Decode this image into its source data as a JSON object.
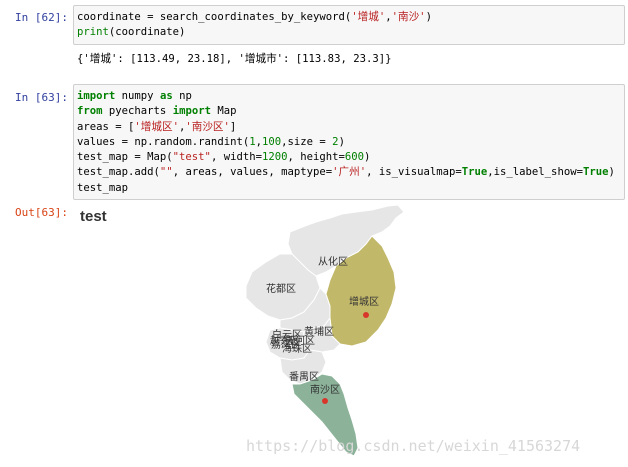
{
  "cells": [
    {
      "prompt": "In [62]:",
      "code_lines": [
        [
          {
            "t": "n",
            "v": "coordinate = search_coordinates_by_keyword("
          },
          {
            "t": "s",
            "v": "'增城'"
          },
          {
            "t": "n",
            "v": ","
          },
          {
            "t": "s",
            "v": "'南沙'"
          },
          {
            "t": "n",
            "v": ")"
          }
        ],
        [
          {
            "t": "b",
            "v": "print"
          },
          {
            "t": "n",
            "v": "(coordinate)"
          }
        ]
      ],
      "output": "{'增城': [113.49, 23.18], '增城市': [113.83, 23.3]}"
    },
    {
      "prompt": "In [63]:",
      "code_lines": [
        [
          {
            "t": "k",
            "v": "import"
          },
          {
            "t": "n",
            "v": " numpy "
          },
          {
            "t": "k",
            "v": "as"
          },
          {
            "t": "n",
            "v": " np"
          }
        ],
        [
          {
            "t": "k",
            "v": "from"
          },
          {
            "t": "n",
            "v": " pyecharts "
          },
          {
            "t": "k",
            "v": "import"
          },
          {
            "t": "n",
            "v": " Map"
          }
        ],
        [
          {
            "t": "n",
            "v": "areas = ["
          },
          {
            "t": "s",
            "v": "'增城区'"
          },
          {
            "t": "n",
            "v": ","
          },
          {
            "t": "s",
            "v": "'南沙区'"
          },
          {
            "t": "n",
            "v": "]"
          }
        ],
        [
          {
            "t": "n",
            "v": "values = np.random.randint("
          },
          {
            "t": "d",
            "v": "1"
          },
          {
            "t": "n",
            "v": ","
          },
          {
            "t": "d",
            "v": "100"
          },
          {
            "t": "n",
            "v": ",size = "
          },
          {
            "t": "d",
            "v": "2"
          },
          {
            "t": "n",
            "v": ")"
          }
        ],
        [
          {
            "t": "n",
            "v": "test_map = Map("
          },
          {
            "t": "s",
            "v": "\"test\""
          },
          {
            "t": "n",
            "v": ", width="
          },
          {
            "t": "d",
            "v": "1200"
          },
          {
            "t": "n",
            "v": ", height="
          },
          {
            "t": "d",
            "v": "600"
          },
          {
            "t": "n",
            "v": ")"
          }
        ],
        [
          {
            "t": "n",
            "v": "test_map.add("
          },
          {
            "t": "s",
            "v": "\"\""
          },
          {
            "t": "n",
            "v": ", areas, values, maptype="
          },
          {
            "t": "s",
            "v": "'广州'"
          },
          {
            "t": "n",
            "v": ", is_visualmap="
          },
          {
            "t": "k",
            "v": "True"
          },
          {
            "t": "n",
            "v": ",is_label_show="
          },
          {
            "t": "k",
            "v": "True"
          },
          {
            "t": "n",
            "v": ")"
          }
        ],
        [
          {
            "t": "n",
            "v": "test_map"
          }
        ]
      ],
      "out_prompt": "Out[63]:"
    }
  ],
  "map": {
    "title": "test",
    "districts": [
      {
        "name": "从化区",
        "highlight": false
      },
      {
        "name": "花都区",
        "highlight": false
      },
      {
        "name": "增城区",
        "highlight": true,
        "color": "#c2b86a"
      },
      {
        "name": "黄埔区",
        "highlight": false
      },
      {
        "name": "白云区",
        "highlight": false
      },
      {
        "name": "越秀区",
        "highlight": false
      },
      {
        "name": "荔湾区",
        "highlight": false
      },
      {
        "name": "天河区",
        "highlight": false
      },
      {
        "name": "海珠区",
        "highlight": false
      },
      {
        "name": "番禺区",
        "highlight": false
      },
      {
        "name": "南沙区",
        "highlight": true,
        "color": "#8cb39a"
      }
    ],
    "base_color": "#e6e6e6",
    "marker_color": "#d9362b"
  },
  "watermark": "https://blog.csdn.net/weixin_41563274"
}
